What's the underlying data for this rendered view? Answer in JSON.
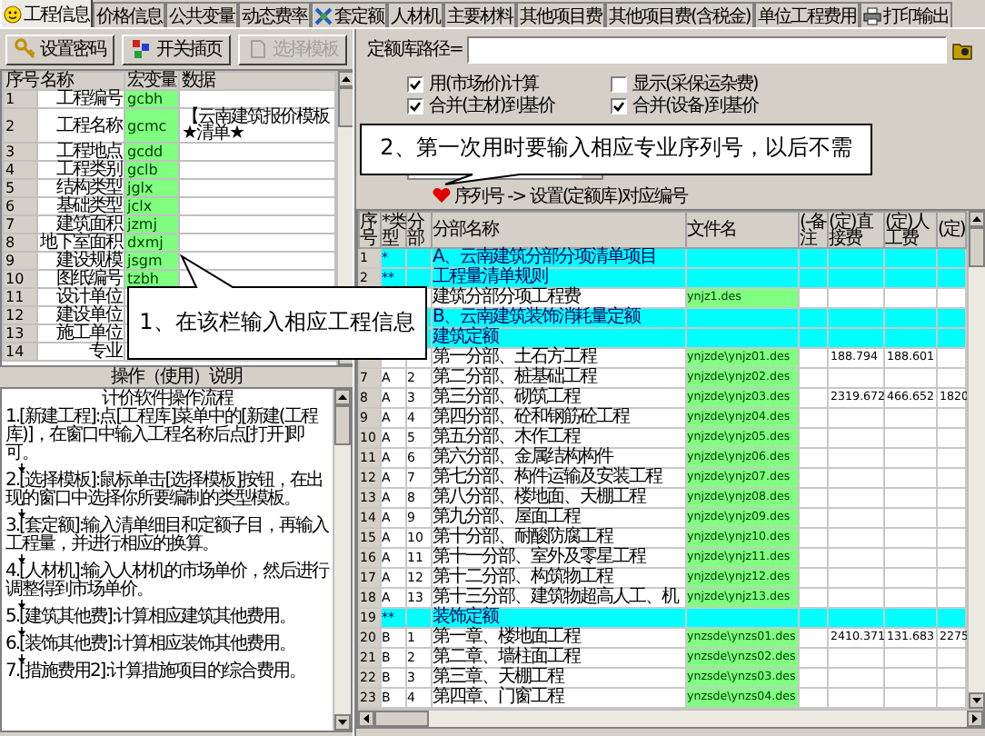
{
  "tabs": [
    {
      "label": "工程信息",
      "kind": "smiley",
      "selected": true
    },
    {
      "label": "价格信息",
      "kind": "plain",
      "selected": false
    },
    {
      "label": "公共变量",
      "kind": "plain",
      "selected": false
    },
    {
      "label": "动态费率",
      "kind": "plain",
      "selected": false
    },
    {
      "label": "套定额",
      "kind": "tools",
      "selected": false
    },
    {
      "label": "人材机",
      "kind": "plain",
      "selected": false
    },
    {
      "label": "主要材料",
      "kind": "plain",
      "selected": false
    },
    {
      "label": "其他项目费",
      "kind": "plain",
      "selected": false
    },
    {
      "label": "其他项目费(含税金)",
      "kind": "plain",
      "selected": false
    },
    {
      "label": "单位工程费用",
      "kind": "plain",
      "selected": false
    },
    {
      "label": "打印输出",
      "kind": "printer",
      "selected": false
    }
  ],
  "toolbar": [
    {
      "label": "设置密码",
      "kind": "key",
      "disabled": false
    },
    {
      "label": "开关插页",
      "kind": "blocks",
      "disabled": false
    },
    {
      "label": "选择模板",
      "kind": "template",
      "disabled": true
    }
  ],
  "project_table": {
    "columns": [
      "序号",
      "名称",
      "宏变量",
      "数据"
    ],
    "rows": [
      {
        "index": "1",
        "name": "工程编号",
        "macro": "gcbh"
      },
      {
        "index": "2",
        "name": "工程名称",
        "macro": "gcmc",
        "data": "【云南建筑报价模板★清单★"
      },
      {
        "index": "3",
        "name": "工程地点",
        "macro": "gcdd"
      },
      {
        "index": "4",
        "name": "工程类别",
        "macro": "gclb"
      },
      {
        "index": "5",
        "name": "结构类型",
        "macro": "jglx"
      },
      {
        "index": "6",
        "name": "基础类型",
        "macro": "jclx"
      },
      {
        "index": "7",
        "name": "建筑面积",
        "macro": "jzmj"
      },
      {
        "index": "8",
        "name": "地下室面积",
        "macro": "dxmj"
      },
      {
        "index": "9",
        "name": "建设规模",
        "macro": "jsgm"
      },
      {
        "index": "10",
        "name": "图纸编号",
        "macro": "tzbh"
      },
      {
        "index": "11",
        "name": "设计单位"
      },
      {
        "index": "12",
        "name": "建设单位"
      },
      {
        "index": "13",
        "name": "施工单位"
      },
      {
        "index": "14",
        "name": "专业"
      }
    ]
  },
  "help": {
    "caption": "操作（使用）说明",
    "title": "计价软件操作流程",
    "steps": [
      "1.[新建工程]:点[工程库]菜单中的[新建(工程库)]，在窗口中输入工程名称后点[打开]即可。",
      "2.[选择模板]:鼠标单击[选择模板]按钮，在出现的窗口中选择你所要编制的类型模板。",
      "3.[套定额]:输入清单细目和定额子目，再输入工程量，并进行相应的换算。",
      "4.[人材机]:输入人材机的市场单价，然后进行调整得到市场单价。",
      "5.[建筑其他费]:计算相应建筑其他费用。",
      "6.[装饰其他费]:计算相应装饰其他费用。",
      "7.[措施费用2]:计算措施项目的综合费用。"
    ]
  },
  "library_path": {
    "label": "定额库路径="
  },
  "options": [
    {
      "label": "用(市场价)计算",
      "checked": true
    },
    {
      "label": "显示(采保运杂费)",
      "checked": false
    },
    {
      "label": "合并(主材)到基价",
      "checked": true
    },
    {
      "label": "合并(设备)到基价",
      "checked": true
    }
  ],
  "serial_hint": "序列号 -> 设置(定额库)对应编号",
  "chapters_table": {
    "columns": [
      "序号",
      "*类型",
      "分部",
      "分部名称",
      "文件名",
      "(-备注",
      "(定)直接费",
      "(定)人工费",
      "(定)"
    ],
    "rows": [
      {
        "index": "1",
        "kind": "heading",
        "type": "*",
        "name": "A、云南建筑分部分项清单项目"
      },
      {
        "index": "2",
        "kind": "heading",
        "type": "**",
        "name": "工程量清单规则"
      },
      {
        "kind": "item",
        "name": "建筑分部分项工程费",
        "file": "ynjz1.des"
      },
      {
        "kind": "heading",
        "name": "B、云南建筑装饰消耗量定额"
      },
      {
        "kind": "heading",
        "name": "建筑定额"
      },
      {
        "kind": "item",
        "name": "第一分部、土石方工程",
        "file": "ynjzde\\ynjz01.des",
        "direct": "188.794",
        "labor": "188.601"
      },
      {
        "index": "7",
        "kind": "item",
        "type": "A",
        "section": "2",
        "name": "第二分部、桩基础工程",
        "file": "ynjzde\\ynjz02.des"
      },
      {
        "index": "8",
        "kind": "item",
        "type": "A",
        "section": "3",
        "name": "第三分部、砌筑工程",
        "file": "ynjzde\\ynjz03.des",
        "direct": "2319.672",
        "labor": "466.652",
        "extra": "1820"
      },
      {
        "index": "9",
        "kind": "item",
        "type": "A",
        "section": "4",
        "name": "第四分部、砼和钢筋砼工程",
        "file": "ynjzde\\ynjz04.des"
      },
      {
        "index": "10",
        "kind": "item",
        "type": "A",
        "section": "5",
        "name": "第五分部、木作工程",
        "file": "ynjzde\\ynjz05.des"
      },
      {
        "index": "11",
        "kind": "item",
        "type": "A",
        "section": "6",
        "name": "第六分部、金属结构构件",
        "file": "ynjzde\\ynjz06.des"
      },
      {
        "index": "12",
        "kind": "item",
        "type": "A",
        "section": "7",
        "name": "第七分部、构件运输及安装工程",
        "file": "ynjzde\\ynjz07.des"
      },
      {
        "index": "13",
        "kind": "item",
        "type": "A",
        "section": "8",
        "name": "第八分部、楼地面、天棚工程",
        "file": "ynjzde\\ynjz08.des"
      },
      {
        "index": "14",
        "kind": "item",
        "type": "A",
        "section": "9",
        "name": "第九分部、屋面工程",
        "file": "ynjzde\\ynjz09.des"
      },
      {
        "index": "15",
        "kind": "item",
        "type": "A",
        "section": "10",
        "name": "第十分部、耐酸防腐工程",
        "file": "ynjzde\\ynjz10.des"
      },
      {
        "index": "16",
        "kind": "item",
        "type": "A",
        "section": "11",
        "name": "第十一分部、室外及零星工程",
        "file": "ynjzde\\ynjz11.des"
      },
      {
        "index": "17",
        "kind": "item",
        "type": "A",
        "section": "12",
        "name": "第十二分部、构筑物工程",
        "file": "ynjzde\\ynjz12.des"
      },
      {
        "index": "18",
        "kind": "item",
        "type": "A",
        "section": "13",
        "name": "第十三分部、建筑物超高人工、机",
        "file": "ynjzde\\ynjz13.des"
      },
      {
        "index": "19",
        "kind": "heading",
        "type": "**",
        "name": "装饰定额"
      },
      {
        "index": "20",
        "kind": "item",
        "type": "B",
        "section": "1",
        "name": "第一章、楼地面工程",
        "file": "ynzsde\\ynzs01.des",
        "direct": "2410.371",
        "labor": "131.683",
        "extra": "2275"
      },
      {
        "index": "21",
        "kind": "item",
        "type": "B",
        "section": "2",
        "name": "第二章、墙柱面工程",
        "file": "ynzsde\\ynzs02.des"
      },
      {
        "index": "22",
        "kind": "item",
        "type": "B",
        "section": "3",
        "name": "第三章、天棚工程",
        "file": "ynzsde\\ynzs03.des"
      },
      {
        "index": "23",
        "kind": "item",
        "type": "B",
        "section": "4",
        "name": "第四章、门窗工程",
        "file": "ynzsde\\ynzs04.des"
      }
    ]
  },
  "callouts": [
    {
      "text": "1、在该栏输入相应工程信息"
    },
    {
      "text": "2、第一次用时要输入相应专业序列号，以后不需"
    }
  ]
}
